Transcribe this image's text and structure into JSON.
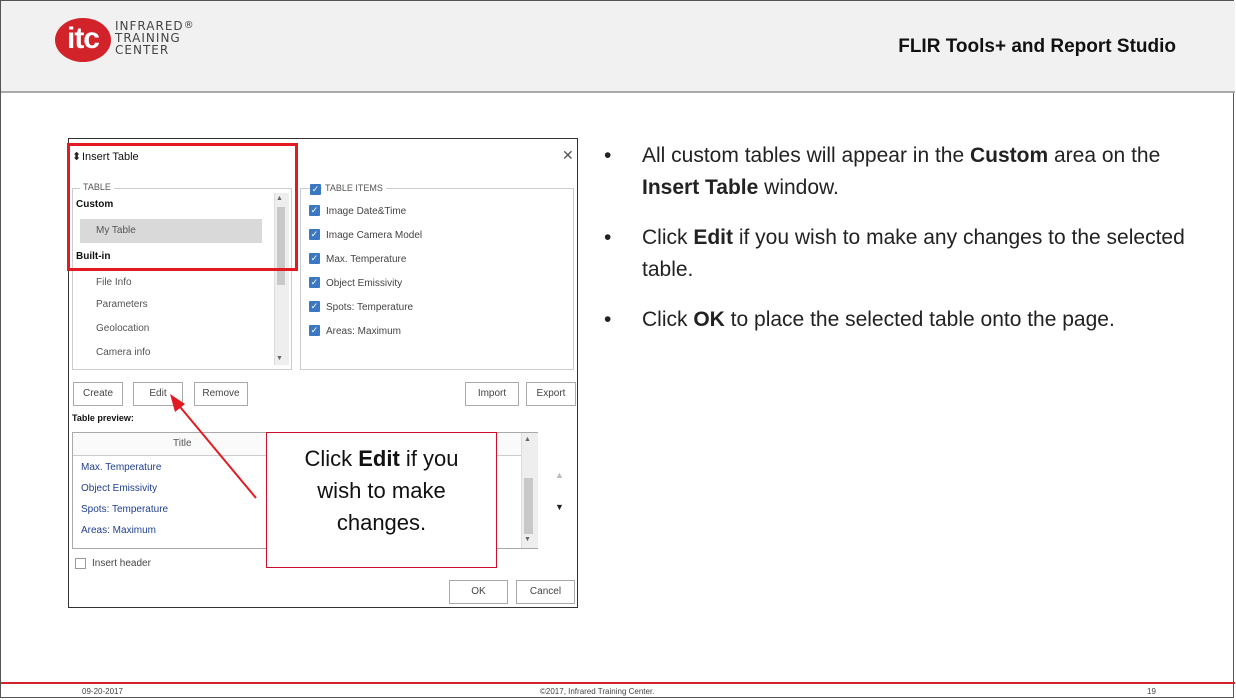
{
  "header": {
    "logo_mark": "itc",
    "logo_lines": [
      "INFRARED",
      "TRAINING",
      "CENTER"
    ],
    "logo_registered": "®",
    "title": "FLIR Tools+ and Report Studio"
  },
  "dialog": {
    "title": "Insert Table",
    "close_icon": "close-icon",
    "table_group_label": "TABLE",
    "categories": {
      "custom": "Custom",
      "custom_items": [
        "My Table"
      ],
      "builtin": "Built-in",
      "builtin_items": [
        "File Info",
        "Parameters",
        "Geolocation",
        "Camera info"
      ]
    },
    "table_items_label": "TABLE ITEMS",
    "table_items": [
      "Image Date&Time",
      "Image Camera Model",
      "Max. Temperature",
      "Object Emissivity",
      "Spots: Temperature",
      "Areas: Maximum"
    ],
    "buttons": {
      "create": "Create",
      "edit": "Edit",
      "remove": "Remove",
      "import": "Import",
      "export": "Export",
      "ok": "OK",
      "cancel": "Cancel"
    },
    "preview_label": "Table preview:",
    "preview_column": "Title",
    "preview_rows": [
      "Max. Temperature",
      "Object Emissivity",
      "Spots: Temperature",
      "Areas: Maximum"
    ],
    "insert_header_label": "Insert header"
  },
  "callout": {
    "line1_pre": "Click ",
    "line1_bold": "Edit",
    "line1_post": " if you",
    "line2": "wish to make",
    "line3": "changes."
  },
  "bullets": [
    {
      "parts": [
        {
          "t": "All custom tables will appear in the "
        },
        {
          "t": "Custom",
          "b": true
        },
        {
          "t": " area on the "
        },
        {
          "t": "Insert Table",
          "b": true
        },
        {
          "t": " window."
        }
      ]
    },
    {
      "parts": [
        {
          "t": "Click "
        },
        {
          "t": "Edit",
          "b": true
        },
        {
          "t": " if you wish to make any changes to the selected table."
        }
      ]
    },
    {
      "parts": [
        {
          "t": "Click "
        },
        {
          "t": "OK",
          "b": true
        },
        {
          "t": " to place the selected table onto the page."
        }
      ]
    }
  ],
  "footer": {
    "date": "09-20-2017",
    "copyright": "©2017, Infrared Training Center.",
    "page": "19"
  },
  "colors": {
    "brand_red": "#d2232a",
    "check_blue": "#3b78c2",
    "link_blue": "#1f3f8f"
  }
}
